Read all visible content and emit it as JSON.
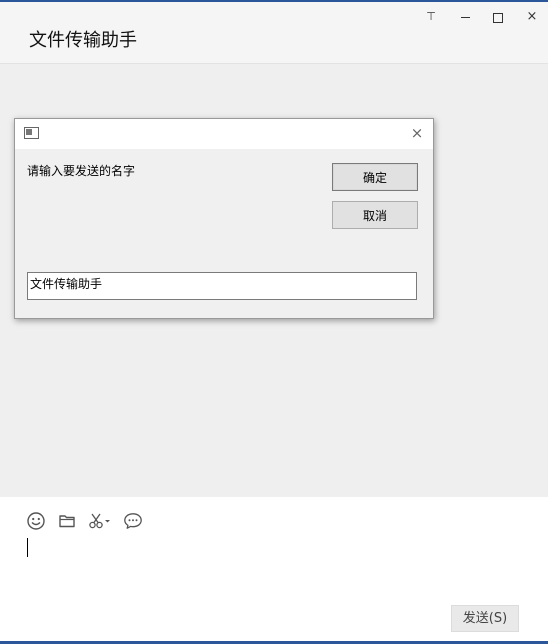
{
  "window": {
    "title": "文件传输助手",
    "controls": {
      "pin_glyph": "⊤",
      "close_glyph": "×"
    }
  },
  "dialog": {
    "close_glyph": "×",
    "prompt": "请输入要发送的名字",
    "ok_label": "确定",
    "cancel_label": "取消",
    "input_value": "文件传输助手"
  },
  "composer": {
    "tools": [
      "emoji-icon",
      "folder-icon",
      "scissors-icon",
      "chat-bubble-icon"
    ],
    "send_label": "发送(S)"
  },
  "colors": {
    "accent": "#2b579a",
    "background": "#f0f0f0",
    "composer_bg": "#ffffff"
  }
}
